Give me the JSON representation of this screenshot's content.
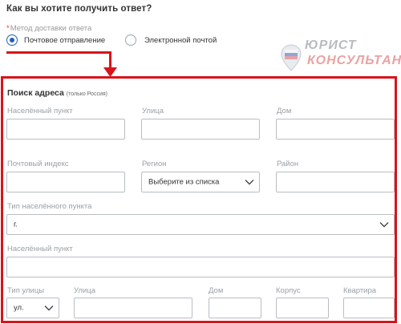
{
  "question": "Как вы хотите получить ответ?",
  "method": {
    "required_mark": "*",
    "label": "Метод доставки ответа",
    "options": [
      {
        "label": "Почтовое отправление",
        "selected": true
      },
      {
        "label": "Электронной почтой",
        "selected": false
      }
    ]
  },
  "watermark": {
    "line1": "ЮРИСТ",
    "line2": "КОНСУЛЬТАНТ"
  },
  "address": {
    "title": "Поиск адреса",
    "note": "(только Россия)",
    "locality_label": "Населённый пункт",
    "street_label": "Улица",
    "house_label": "Дом",
    "postcode_label": "Почтовый индекс",
    "region_label": "Регион",
    "region_value": "Выберите из списка",
    "district_label": "Район",
    "locality_type_label": "Тип населённого пункта",
    "locality_type_value": "г.",
    "locality2_label": "Населённый пункт",
    "street_type_label": "Тип улицы",
    "street_type_value": "ул.",
    "street2_label": "Улица",
    "house2_label": "Дом",
    "building_label": "Корпус",
    "apartment_label": "Квартира"
  },
  "colors": {
    "accent": "#1e62b8",
    "highlight": "#d8141a"
  }
}
